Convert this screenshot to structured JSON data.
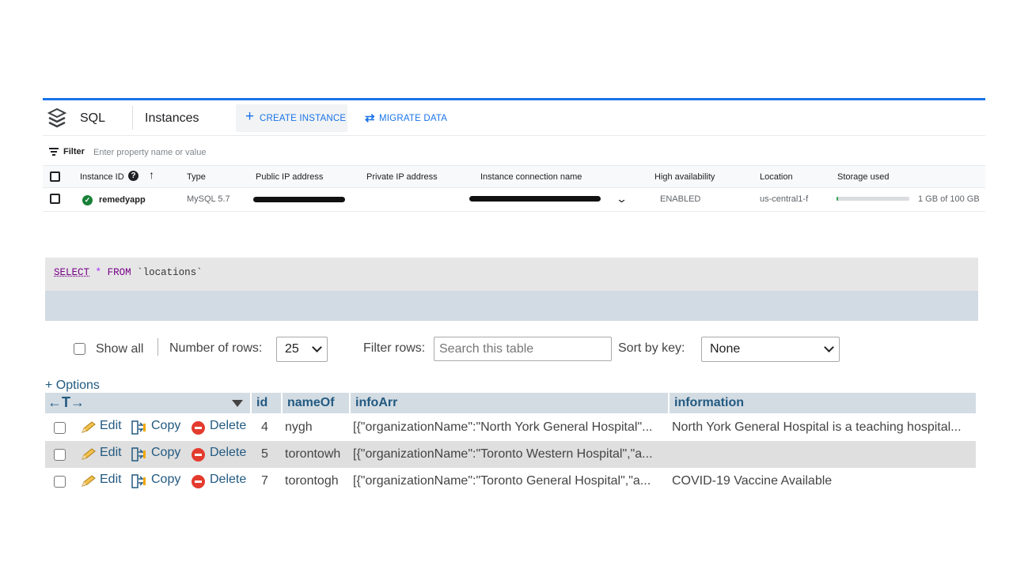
{
  "cloud": {
    "product": "SQL",
    "page_title": "Instances",
    "create_label": "CREATE INSTANCE",
    "migrate_label": "MIGRATE DATA",
    "filter_label": "Filter",
    "filter_placeholder": "Enter property name or value",
    "columns": [
      "Instance ID",
      "Type",
      "Public IP address",
      "Private IP address",
      "Instance connection name",
      "High availability",
      "Location",
      "Storage used"
    ],
    "instance": {
      "id": "remedyapp",
      "type": "MySQL 5.7",
      "high_availability": "ENABLED",
      "location": "us-central1-f",
      "storage_text": "1 GB of 100 GB",
      "storage_fraction": 0.01
    }
  },
  "query": {
    "select": "SELECT",
    "star": "*",
    "from": "FROM",
    "table": "`locations`"
  },
  "controls": {
    "show_all": "Show all",
    "rows_label": "Number of rows:",
    "rows_value": "25",
    "filter_rows_label": "Filter rows:",
    "search_placeholder": "Search this table",
    "sort_label": "Sort by key:",
    "sort_value": "None",
    "options": "+ Options"
  },
  "table": {
    "arrows": "←T→",
    "columns": [
      "id",
      "nameOf",
      "infoArr",
      "information"
    ],
    "actions": {
      "edit": "Edit",
      "copy": "Copy",
      "delete": "Delete"
    },
    "rows": [
      {
        "id": "4",
        "nameOf": "nygh",
        "infoArr": "[{\"organizationName\":\"North York General Hospital\"...",
        "information": "North York General Hospital is a teaching hospital..."
      },
      {
        "id": "5",
        "nameOf": "torontowh",
        "infoArr": "[{\"organizationName\":\"Toronto Western Hospital\",\"a...",
        "information": ""
      },
      {
        "id": "7",
        "nameOf": "torontogh",
        "infoArr": "[{\"organizationName\":\"Toronto General Hospital\",\"a...",
        "information": "COVID-19 Vaccine Available"
      }
    ]
  },
  "colors": {
    "gcp_blue": "#1a73e8",
    "status_green": "#188038",
    "pma_link": "#235a81",
    "pma_header": "#d3dce3",
    "delete_red": "#e33b2e"
  },
  "icons": [
    "sql-stack-icon",
    "plus-icon",
    "migrate-arrows-icon",
    "filter-icon",
    "help-icon",
    "sort-up-arrow-icon",
    "check-circle-icon",
    "chevron-down-icon",
    "pencil-icon",
    "copy-icon",
    "delete-icon"
  ]
}
